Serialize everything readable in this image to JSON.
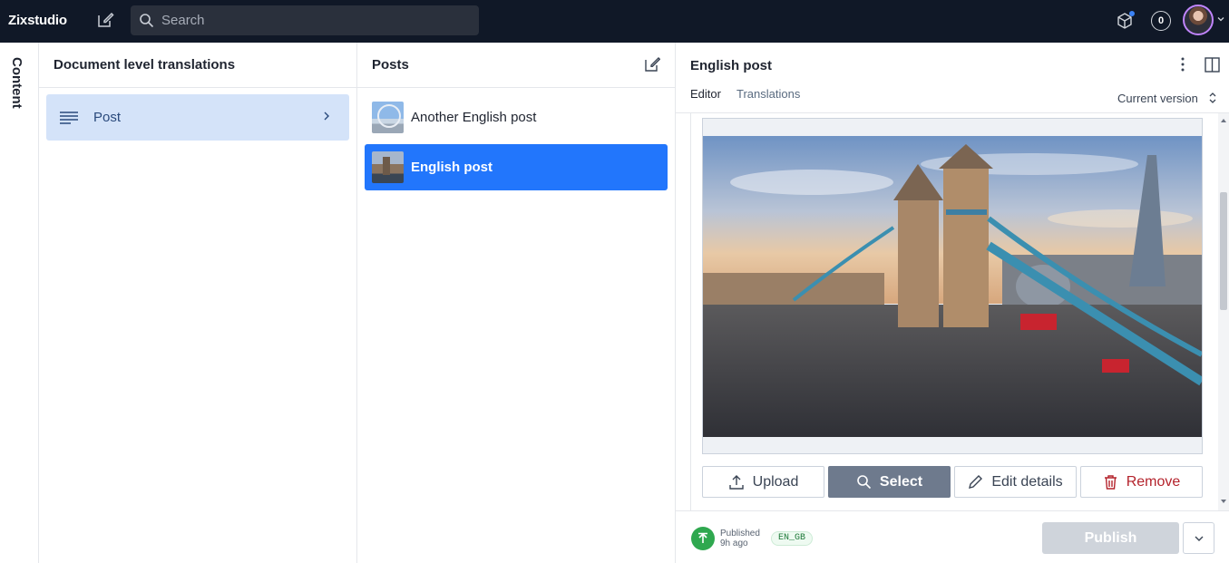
{
  "topbar": {
    "brand": "Zixstudio",
    "search_placeholder": "Search",
    "notification_count": "0"
  },
  "rail": {
    "label": "Content"
  },
  "pane_types": {
    "title": "Document level translations",
    "items": [
      {
        "label": "Post"
      }
    ]
  },
  "pane_docs": {
    "title": "Posts",
    "items": [
      {
        "label": "Another English post"
      },
      {
        "label": "English post"
      }
    ]
  },
  "editor": {
    "title": "English post",
    "tabs": [
      {
        "label": "Editor"
      },
      {
        "label": "Translations"
      }
    ],
    "version": "Current version",
    "image_buttons": {
      "upload": "Upload",
      "select": "Select",
      "edit": "Edit details",
      "remove": "Remove"
    },
    "footer": {
      "status_line1": "Published",
      "status_line2": "9h ago",
      "locale": "EN_GB",
      "publish": "Publish"
    }
  },
  "colors": {
    "topbar_bg": "#101827",
    "selected_doc": "#2276fc",
    "selected_type": "#d4e3f9",
    "published_green": "#2fa84f",
    "remove_red": "#b4232c"
  }
}
